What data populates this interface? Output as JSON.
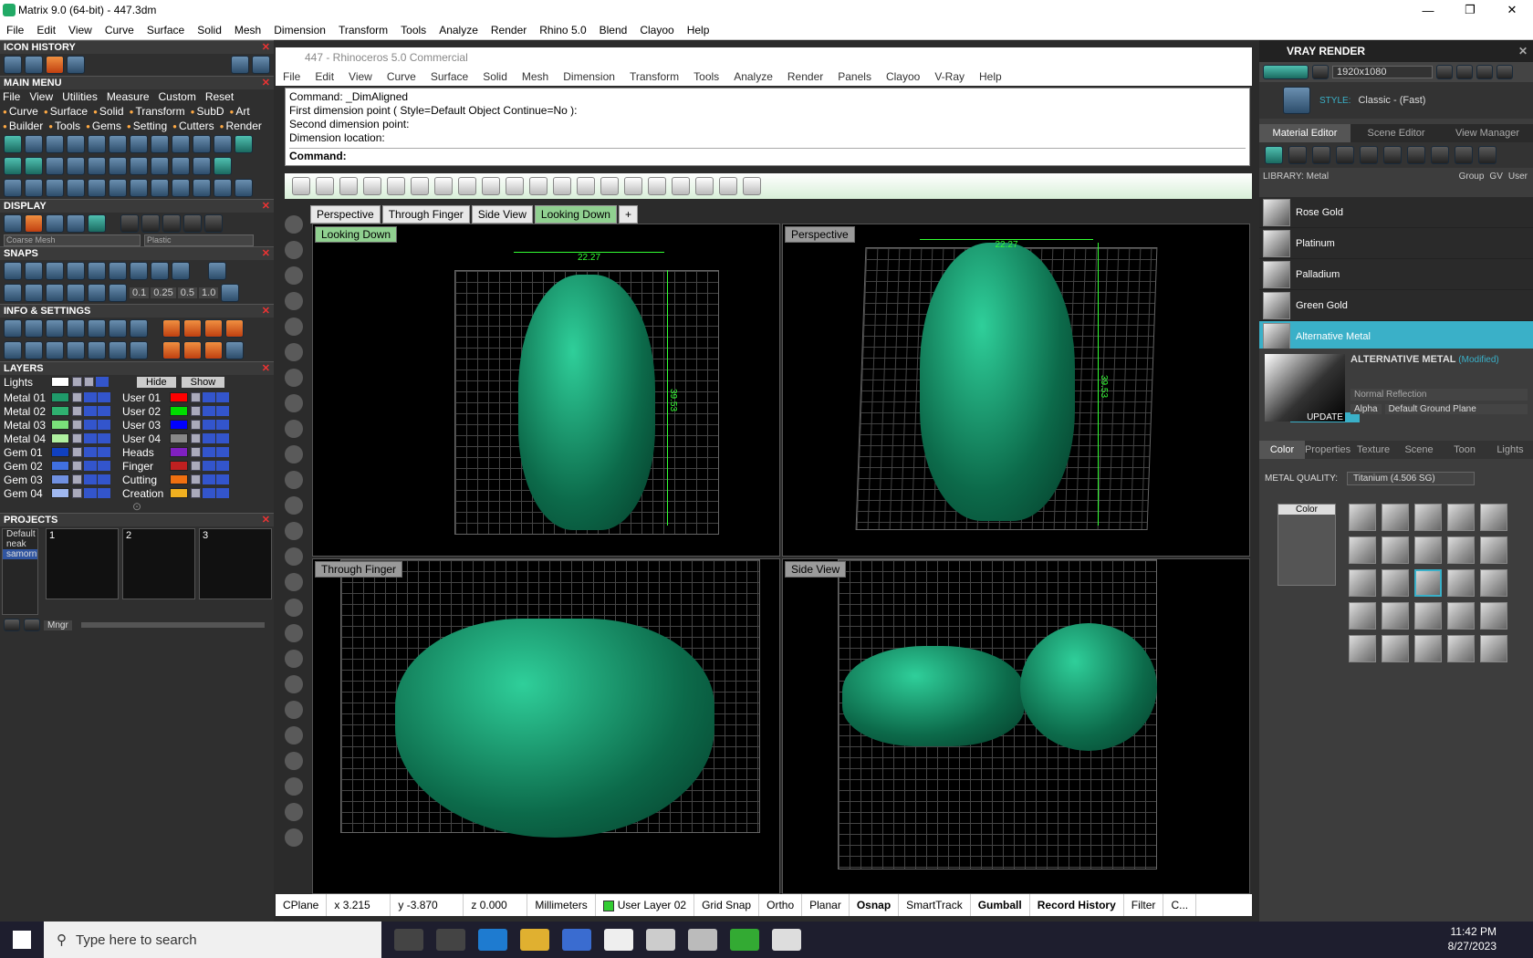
{
  "window": {
    "title": "Matrix 9.0 (64-bit) - 447.3dm",
    "minimize": "—",
    "maximize": "❐",
    "close": "✕"
  },
  "menu": [
    "File",
    "Edit",
    "View",
    "Curve",
    "Surface",
    "Solid",
    "Mesh",
    "Dimension",
    "Transform",
    "Tools",
    "Analyze",
    "Render",
    "Rhino 5.0",
    "Blend",
    "Clayoo",
    "Help"
  ],
  "left": {
    "icon_history": "ICON HISTORY",
    "main_menu": "MAIN MENU",
    "main_menu_items": [
      "File",
      "View",
      "Utilities",
      "Measure",
      "Custom",
      "Reset"
    ],
    "builder_row1": [
      "Curve",
      "Surface",
      "Solid",
      "Transform",
      "SubD",
      "Art"
    ],
    "builder_row2": [
      "Builder",
      "Tools",
      "Gems",
      "Setting",
      "Cutters",
      "Render"
    ],
    "display": "DISPLAY",
    "display_mesh": "Coarse Mesh",
    "display_mat": "Plastic",
    "snaps": "SNAPS",
    "snap_values": [
      "0.1",
      "0.25",
      "0.5",
      "1.0"
    ],
    "info": "INFO & SETTINGS",
    "layers": "LAYERS",
    "lights": "Lights",
    "hide": "Hide",
    "show": "Show",
    "layers_left": [
      {
        "n": "Metal 01",
        "c": "#1f9a6a"
      },
      {
        "n": "Metal 02",
        "c": "#2fb070"
      },
      {
        "n": "Metal 03",
        "c": "#7ae07a"
      },
      {
        "n": "Metal 04",
        "c": "#b0f0a0"
      },
      {
        "n": "Gem 01",
        "c": "#1040c0"
      },
      {
        "n": "Gem 02",
        "c": "#4070e0"
      },
      {
        "n": "Gem 03",
        "c": "#7090e0"
      },
      {
        "n": "Gem 04",
        "c": "#a0b8f0"
      }
    ],
    "layers_right": [
      {
        "n": "User 01",
        "c": "#ff0000"
      },
      {
        "n": "User 02",
        "c": "#00dd00"
      },
      {
        "n": "User 03",
        "c": "#0000ff"
      },
      {
        "n": "User 04",
        "c": "#888888"
      },
      {
        "n": "Heads",
        "c": "#8020c0"
      },
      {
        "n": "Finger",
        "c": "#c02020"
      },
      {
        "n": "Cutting",
        "c": "#f07010"
      },
      {
        "n": "Creation",
        "c": "#f0b020"
      }
    ],
    "projects": "PROJECTS",
    "project_list": [
      "Default",
      "neak",
      "samorn"
    ],
    "project_thumbs": [
      "1",
      "2",
      "3"
    ],
    "mngr": "Mngr"
  },
  "rhino": {
    "title": "447 - Rhinoceros 5.0 Commercial",
    "menu": [
      "File",
      "Edit",
      "View",
      "Curve",
      "Surface",
      "Solid",
      "Mesh",
      "Dimension",
      "Transform",
      "Tools",
      "Analyze",
      "Render",
      "Panels",
      "Clayoo",
      "V-Ray",
      "Help"
    ],
    "cmd_lines": [
      "Command: _DimAligned",
      "First dimension point ( Style=Default  Object  Continue=No ):",
      "Second dimension point:",
      "Dimension location:"
    ],
    "cmd_prompt": "Command:",
    "tabs": [
      "Perspective",
      "Through Finger",
      "Side View",
      "Looking Down"
    ],
    "vp_tl": "Looking Down",
    "vp_tr": "Perspective",
    "vp_bl": "Through Finger",
    "vp_br": "Side View",
    "dim_w": "22.27",
    "dim_h": "39.53"
  },
  "status": {
    "cplane": "CPlane",
    "x": "x 3.215",
    "y": "y -3.870",
    "z": "z 0.000",
    "units": "Millimeters",
    "layer": "User Layer 02",
    "items": [
      "Grid Snap",
      "Ortho",
      "Planar",
      "Osnap",
      "SmartTrack",
      "Gumball",
      "Record History",
      "Filter",
      "C..."
    ]
  },
  "right": {
    "title": "VRAY RENDER",
    "resolution": "1920x1080",
    "style_label": "STYLE:",
    "style_value": "Classic - (Fast)",
    "tabs": [
      "Material Editor",
      "Scene Editor",
      "View Manager"
    ],
    "library": "LIBRARY: Metal",
    "group": "Group",
    "gv": "GV",
    "user": "User",
    "materials": [
      "Rose Gold",
      "Platinum",
      "Palladium",
      "Green Gold",
      "Alternative Metal"
    ],
    "selected_title": "ALTERNATIVE METAL",
    "modified": "(Modified)",
    "reflection": "Normal Reflection",
    "update": "UPDATE",
    "alpha": "Alpha",
    "ground": "Default Ground Plane",
    "subtabs": [
      "Color",
      "Properties",
      "Texture",
      "Scene",
      "Toon",
      "Lights"
    ],
    "metal_quality_label": "METAL QUALITY:",
    "metal_quality_value": "Titanium  (4.506 SG)",
    "color_label": "Color"
  },
  "taskbar": {
    "search": "Type here to search",
    "time": "11:42 PM",
    "date": "8/27/2023"
  }
}
